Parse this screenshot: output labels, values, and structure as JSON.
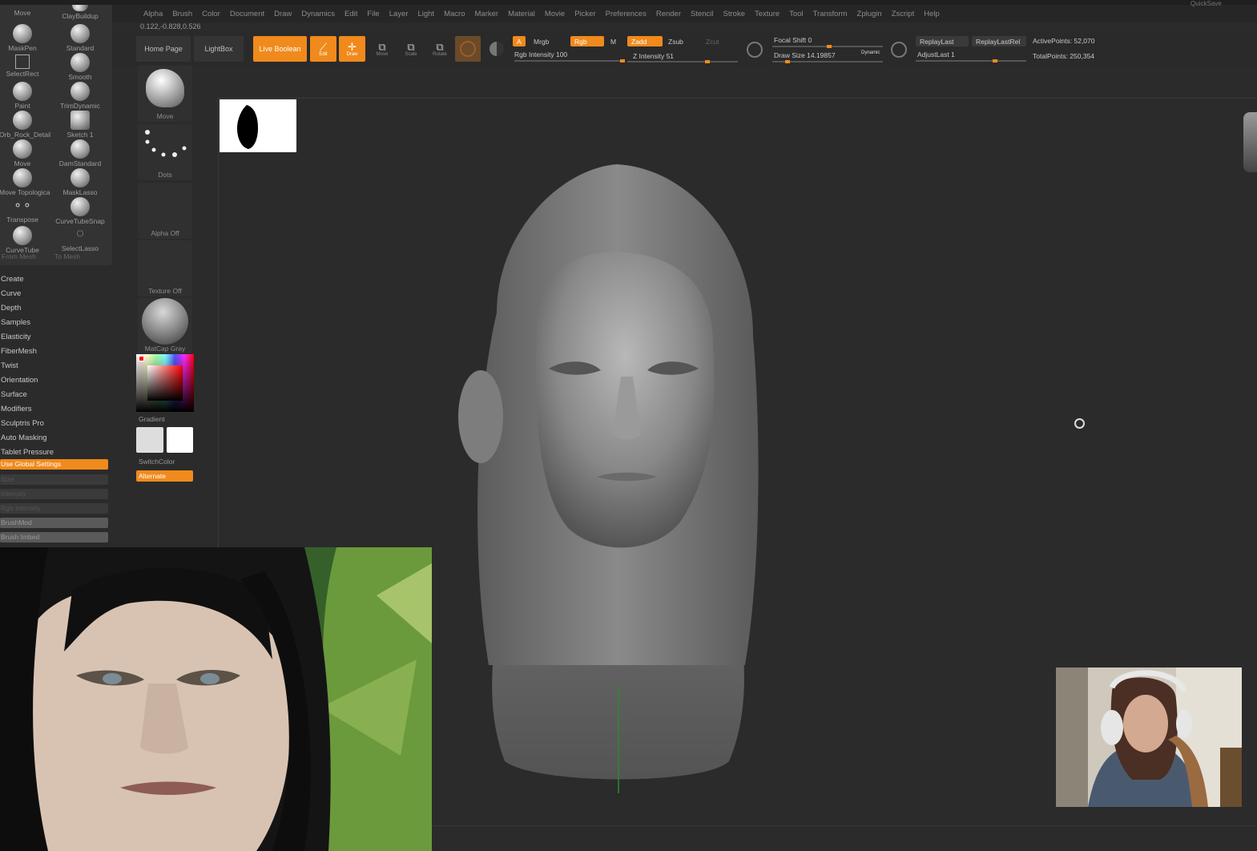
{
  "menubar": {
    "items": [
      "Alpha",
      "Brush",
      "Color",
      "Document",
      "Draw",
      "Dynamics",
      "Edit",
      "File",
      "Layer",
      "Light",
      "Macro",
      "Marker",
      "Material",
      "Movie",
      "Picker",
      "Preferences",
      "Render",
      "Stencil",
      "Stroke",
      "Texture",
      "Tool",
      "Transform",
      "Zplugin",
      "Zscript",
      "Help"
    ]
  },
  "coords": "0.122,-0.828,0.526",
  "toolbar": {
    "home_page": "Home Page",
    "lightbox": "LightBox",
    "live_boolean": "Live Boolean",
    "edit": "Edit",
    "draw": "Draw",
    "move": "Move",
    "scale": "Scale",
    "rotate": "Rotate",
    "a_label": "A",
    "mrgb": "Mrgb",
    "rgb": "Rgb",
    "m": "M",
    "rgb_intensity": "Rgb Intensity 100",
    "rgb_intensity_value": 100,
    "zadd": "Zadd",
    "zsub": "Zsub",
    "zcut": "Zcut",
    "z_intensity": "Z Intensity 51",
    "z_intensity_value": 51,
    "focal_shift": "Focal Shift 0",
    "draw_size": "Draw Size 14.19857",
    "dynamic": "Dynamic",
    "replay_last": "ReplayLast",
    "replay_last_rel": "ReplayLastRel",
    "adjust_last": "AdjustLast 1",
    "active_points": "ActivePoints: 52,070",
    "total_points": "TotalPoints: 250,354",
    "quicksave": "QuickSave"
  },
  "brushes": [
    {
      "label": "Move"
    },
    {
      "label": "ClayBuildup"
    },
    {
      "label": "MaskPen"
    },
    {
      "label": "Standard"
    },
    {
      "label": "SelectRect"
    },
    {
      "label": "Smooth"
    },
    {
      "label": "Paint"
    },
    {
      "label": "TrimDynamic"
    },
    {
      "label": "Orb_Rock_Detail"
    },
    {
      "label": "Sketch 1"
    },
    {
      "label": "Move"
    },
    {
      "label": "DamStandard"
    },
    {
      "label": "Move Topological"
    },
    {
      "label": "MaskLasso"
    },
    {
      "label": "Transpose"
    },
    {
      "label": "CurveTubeSnap"
    },
    {
      "label": "CurveTube"
    },
    {
      "label": "SelectLasso"
    }
  ],
  "from_mesh": "From Mesh",
  "to_mesh": "To Mesh",
  "brush_menu": [
    "Create",
    "Curve",
    "Depth",
    "Samples",
    "Elasticity",
    "FiberMesh",
    "Twist",
    "Orientation",
    "Surface",
    "Modifiers",
    "Sculptris Pro",
    "Auto Masking",
    "Tablet Pressure"
  ],
  "tablet": {
    "use_global": "Use Global Settings",
    "size": "Size",
    "intensity": "Intensity",
    "rgb_intensity": "Rgb Intensity",
    "brush_mod": "BrushMod",
    "brush_imbed": "Brush Imbed"
  },
  "tiles": {
    "move": "Move",
    "dots": "Dots",
    "alpha_off": "Alpha Off",
    "texture_off": "Texture Off",
    "matcap": "MatCap Gray",
    "gradient": "Gradient",
    "switch_color": "SwitchColor",
    "alternate": "Alternate"
  },
  "colors": {
    "accent": "#f08a1c",
    "background": "#2b2b2b",
    "panel": "#333333"
  },
  "icons": {
    "edit": "edit-icon",
    "draw": "draw-icon",
    "move": "move-icon",
    "scale": "scale-icon",
    "rotate": "rotate-icon",
    "cursor": "cursor-ring-icon"
  }
}
